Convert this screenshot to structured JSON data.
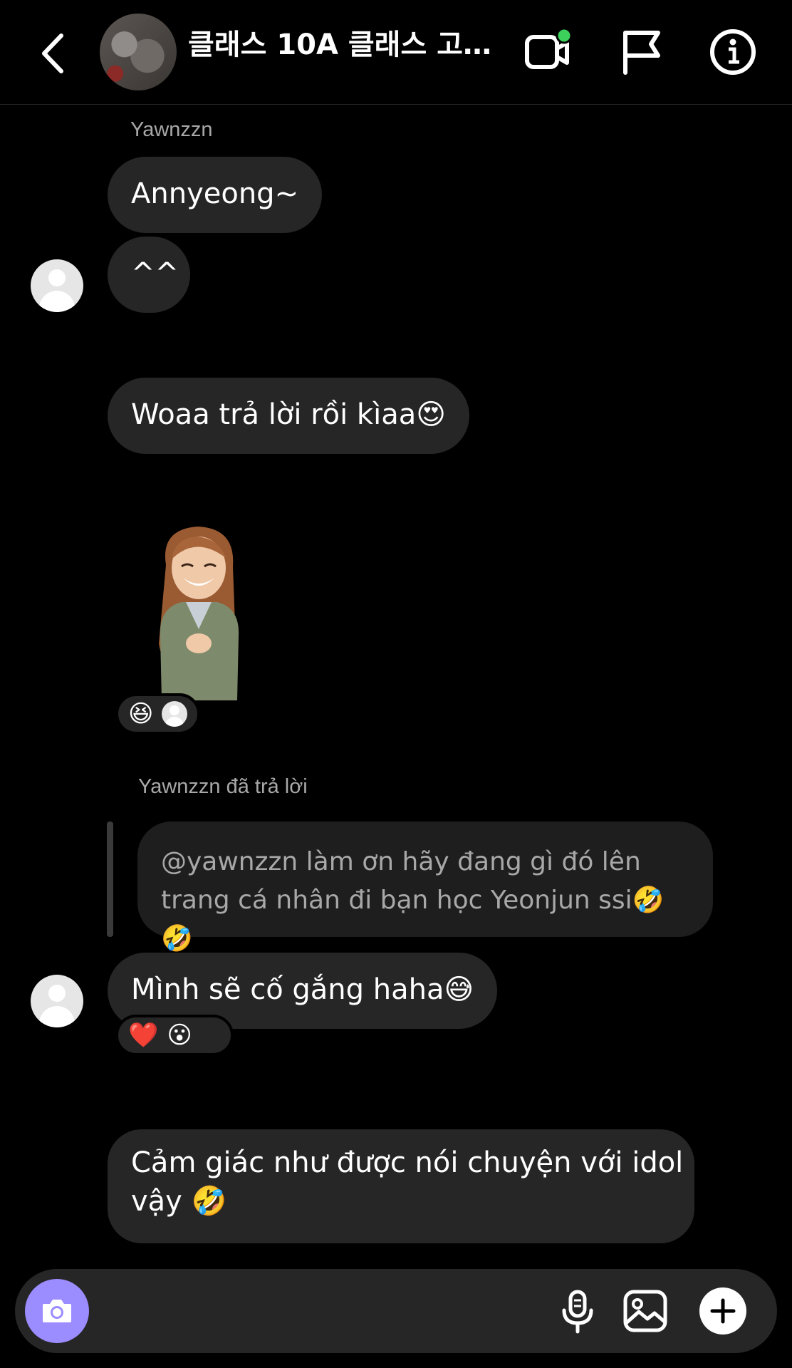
{
  "header": {
    "title": "클래스 10A 클래스 고…"
  },
  "messages": {
    "sender_name": "Yawnzzn",
    "m1": "Annyeong~",
    "m2": "^^",
    "m3": "Woaa trả lời rồi kìaa😍",
    "sticker_reaction": "😆",
    "reply_header": "Yawnzzn đã trả lời",
    "reply_quote_line1": "@yawnzzn        làm ơn hãy đang gì đó lên",
    "reply_quote_line2": "trang cá nhân đi bạn học Yeonjun ssi🤣🤣",
    "m4": "Mình sẽ cố gắng haha😅",
    "m4_reaction_1": "❤️",
    "m4_reaction_2": "😮",
    "m5_line1": "Cảm giác như được nói chuyện với idol",
    "m5_line2": "vậy 🤣"
  },
  "colors": {
    "background": "#000000",
    "bubble": "#262626",
    "camera_button": "#9b8cff",
    "online_dot": "#3bd15a"
  }
}
